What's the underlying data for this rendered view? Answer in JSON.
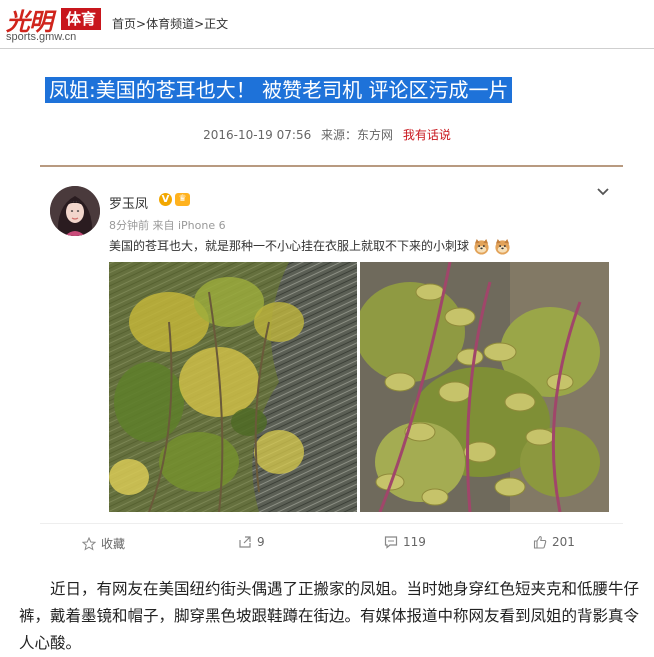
{
  "header": {
    "logo_text": "光明",
    "logo_section": "体育",
    "logo_url": "sports.gmw.cn",
    "breadcrumb": [
      "首页",
      ">",
      "体育频道",
      ">",
      "正文"
    ]
  },
  "article": {
    "title": "凤姐:美国的苍耳也大！  被赞老司机  评论区污成一片",
    "date": "2016-10-19 07:56",
    "source": "来源：东方网",
    "comment_link": "我有话说",
    "body": "近日，有网友在美国纽约街头偶遇了正搬家的凤姐。当时她身穿红色短夹克和低腰牛仔裤，戴着墨镜和帽子，脚穿黑色坡跟鞋蹲在街边。有媒体报道中称网友看到凤姐的背影真令人心酸。"
  },
  "weibo": {
    "username": "罗玉凤",
    "time": "8分钟前 来自 iPhone 6",
    "text": "美国的苍耳也大，就是那种一不小心挂在衣服上就取不下来的小刺球",
    "actions": {
      "favorite": "收藏",
      "repost": "9",
      "comment": "119",
      "like": "201"
    },
    "icons": [
      "verified-icon",
      "level-badge-icon",
      "chevron-down-icon",
      "doge-emoji-icon",
      "star-icon",
      "repost-icon",
      "comment-icon",
      "thumbs-up-icon"
    ]
  },
  "colors": {
    "brand_red": "#c8161d",
    "title_bg": "#1e72d9",
    "divider": "#b89a80"
  }
}
